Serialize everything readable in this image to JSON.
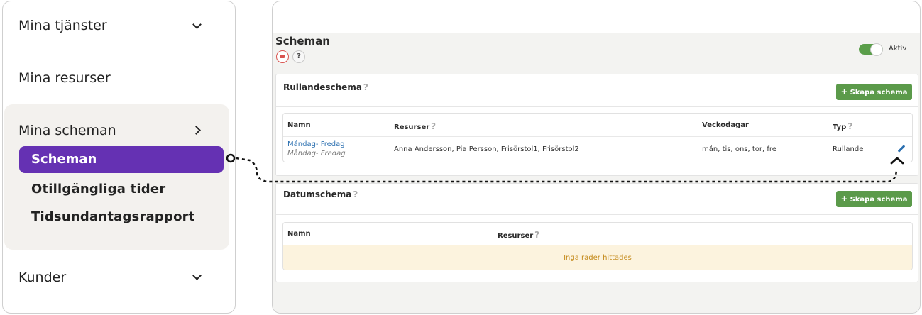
{
  "nav": {
    "items": [
      {
        "label": "Mina tjänster",
        "chevron": "chevron-down-icon"
      },
      {
        "label": "Mina resurser"
      },
      {
        "label": "Mina scheman",
        "chevron": "chevron-right-icon"
      },
      {
        "label": "Kunder",
        "chevron": "chevron-down-icon"
      }
    ],
    "subitems": [
      {
        "label": "Scheman",
        "active": true
      },
      {
        "label": "Otillgängliga tider"
      },
      {
        "label": "Tidsundantagsrapport"
      }
    ],
    "active_color": "#6531b3"
  },
  "page": {
    "title": "Scheman",
    "help": "?",
    "toggle_label": "Aktiv",
    "toggle_on": true
  },
  "rolling": {
    "title": "Rullandeschema",
    "help": "?",
    "create_button": "Skapa schema",
    "columns": {
      "name": "Namn",
      "resources": "Resurser",
      "weekdays": "Veckodagar",
      "type": "Typ",
      "q": "?"
    },
    "rows": [
      {
        "name": "Måndag- Fredag",
        "name_sub": "Måndag- Fredag",
        "resources": "Anna Andersson, Pia Persson, Frisörstol1, Frisörstol2",
        "weekdays": "mån, tis, ons, tor, fre",
        "type": "Rullande"
      }
    ]
  },
  "dated": {
    "title": "Datumschema",
    "help": "?",
    "create_button": "Skapa schema",
    "columns": {
      "name": "Namn",
      "resources": "Resurser",
      "q": "?"
    },
    "empty_text": "Inga rader hittades"
  },
  "colors": {
    "accent_green": "#5b9a4a",
    "link": "#2a6fb0",
    "empty_bg": "#fcf3de",
    "empty_text": "#c48a1b"
  }
}
